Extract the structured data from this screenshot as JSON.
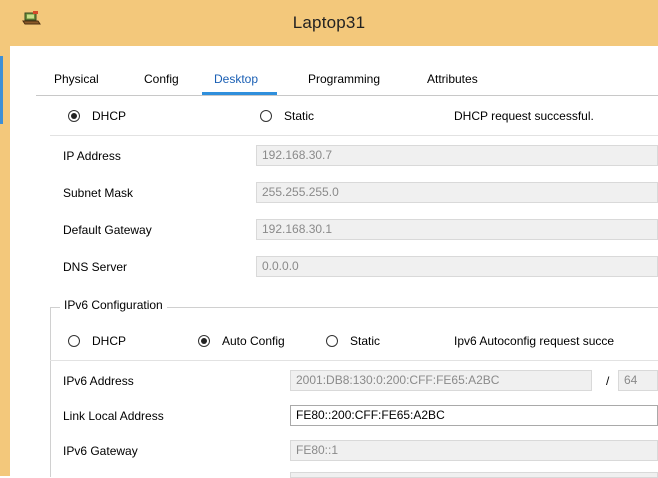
{
  "window": {
    "title": "Laptop31",
    "app_icon": "laptop-app-icon"
  },
  "tabs": [
    {
      "label": "Physical",
      "active": false
    },
    {
      "label": "Config",
      "active": false
    },
    {
      "label": "Desktop",
      "active": true
    },
    {
      "label": "Programming",
      "active": false
    },
    {
      "label": "Attributes",
      "active": false
    }
  ],
  "ipv4": {
    "mode_options": [
      {
        "label": "DHCP",
        "selected": true
      },
      {
        "label": "Static",
        "selected": false
      }
    ],
    "status": "DHCP request successful.",
    "fields": [
      {
        "label": "IP Address",
        "value": "192.168.30.7"
      },
      {
        "label": "Subnet Mask",
        "value": "255.255.255.0"
      },
      {
        "label": "Default Gateway",
        "value": "192.168.30.1"
      },
      {
        "label": "DNS Server",
        "value": "0.0.0.0"
      }
    ]
  },
  "ipv6": {
    "group_title": "IPv6 Configuration",
    "mode_options": [
      {
        "label": "DHCP",
        "selected": false
      },
      {
        "label": "Auto Config",
        "selected": true
      },
      {
        "label": "Static",
        "selected": false
      }
    ],
    "status": "Ipv6 Autoconfig request succe",
    "address_label": "IPv6 Address",
    "address_value": "2001:DB8:130:0:200:CFF:FE65:A2BC",
    "prefix_separator": "/",
    "prefix_value": "64",
    "link_local_label": "Link Local Address",
    "link_local_value": "FE80::200:CFF:FE65:A2BC",
    "gateway_label": "IPv6 Gateway",
    "gateway_value": "FE80::1"
  },
  "colors": {
    "title_bar": "#f3c87b",
    "active_tab": "#1a5fb4",
    "tab_indicator": "#2f8fdc",
    "window_accent": "#3d8fd6"
  }
}
